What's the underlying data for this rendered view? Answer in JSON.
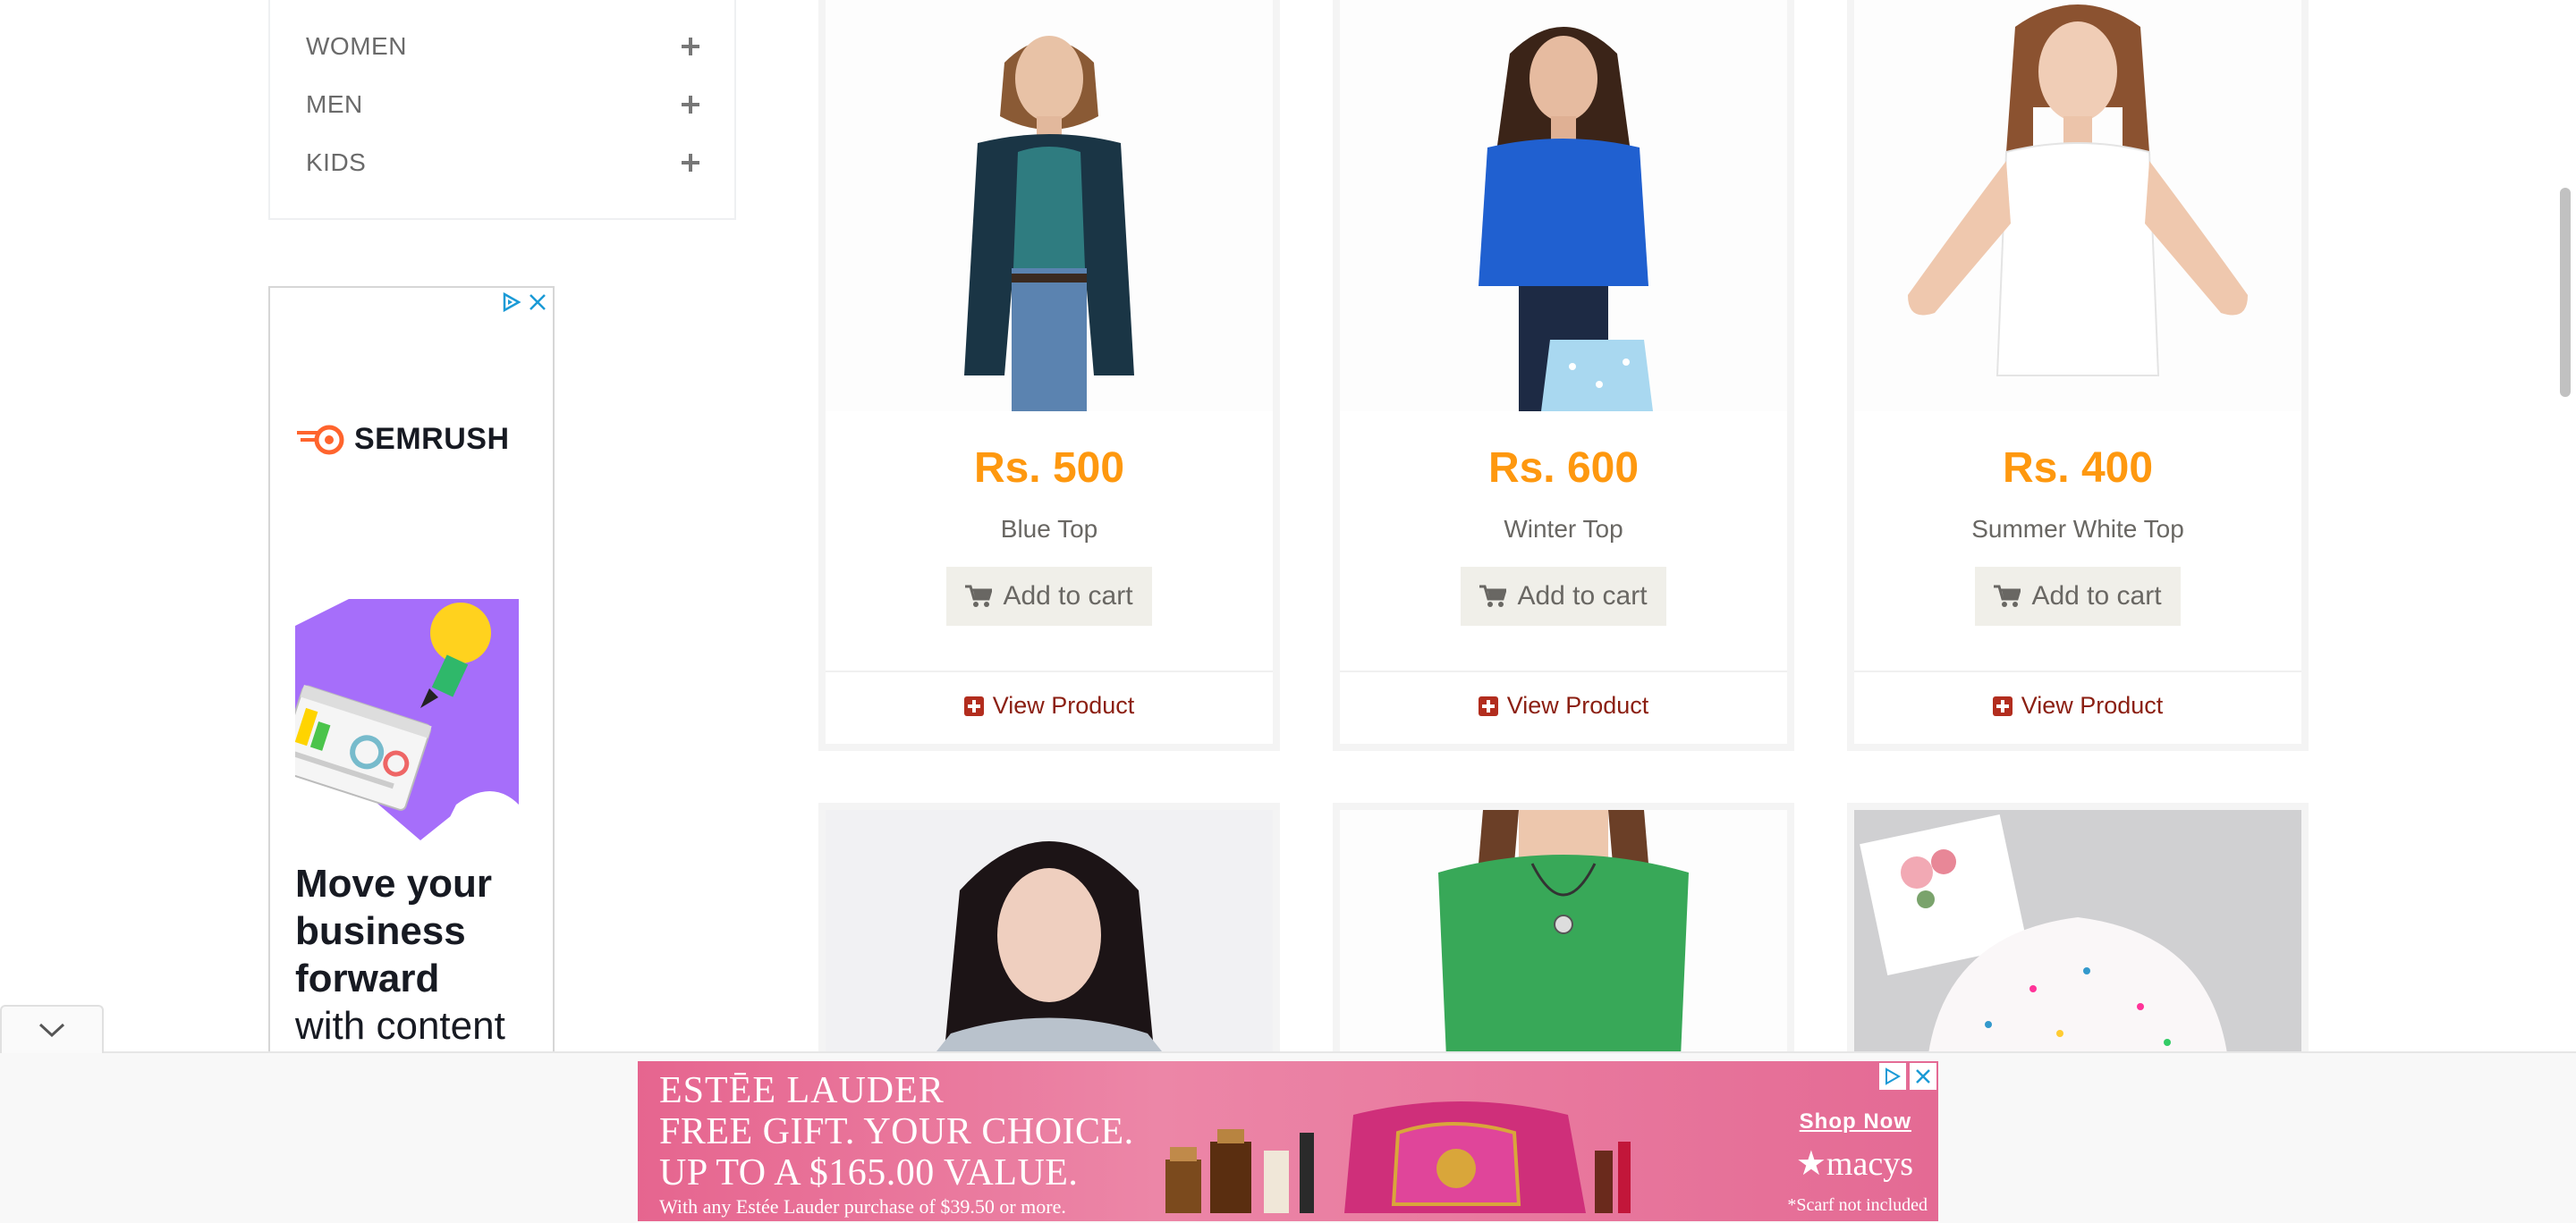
{
  "categories": [
    {
      "label": "WOMEN",
      "icon": "plus-icon"
    },
    {
      "label": "MEN",
      "icon": "plus-icon"
    },
    {
      "label": "KIDS",
      "icon": "plus-icon"
    }
  ],
  "side_ad": {
    "brand": "SEMRUSH",
    "headline_bold": [
      "Move your",
      "business",
      "forward"
    ],
    "headline_normal": "with content",
    "accent_color": "#ff642d",
    "illustration_color": "#a66efa"
  },
  "products": [
    {
      "price": "Rs. 500",
      "name": "Blue Top",
      "cart_label": "Add to cart",
      "view_label": "View Product"
    },
    {
      "price": "Rs. 600",
      "name": "Winter Top",
      "cart_label": "Add to cart",
      "view_label": "View Product"
    },
    {
      "price": "Rs. 400",
      "name": "Summer White Top",
      "cart_label": "Add to cart",
      "view_label": "View Product"
    }
  ],
  "price_color": "#fe980f",
  "bottom_ad": {
    "brand": "ESTĒE LAUDER",
    "line1": "FREE GIFT. YOUR CHOICE.",
    "line2": "UP TO A $165.00 VALUE.",
    "fine_print": "With any Estée Lauder purchase of $39.50 or more.",
    "cta": "Shop Now",
    "retailer": "★macys",
    "note": "*Scarf not included",
    "background_color": "#e6658f"
  }
}
